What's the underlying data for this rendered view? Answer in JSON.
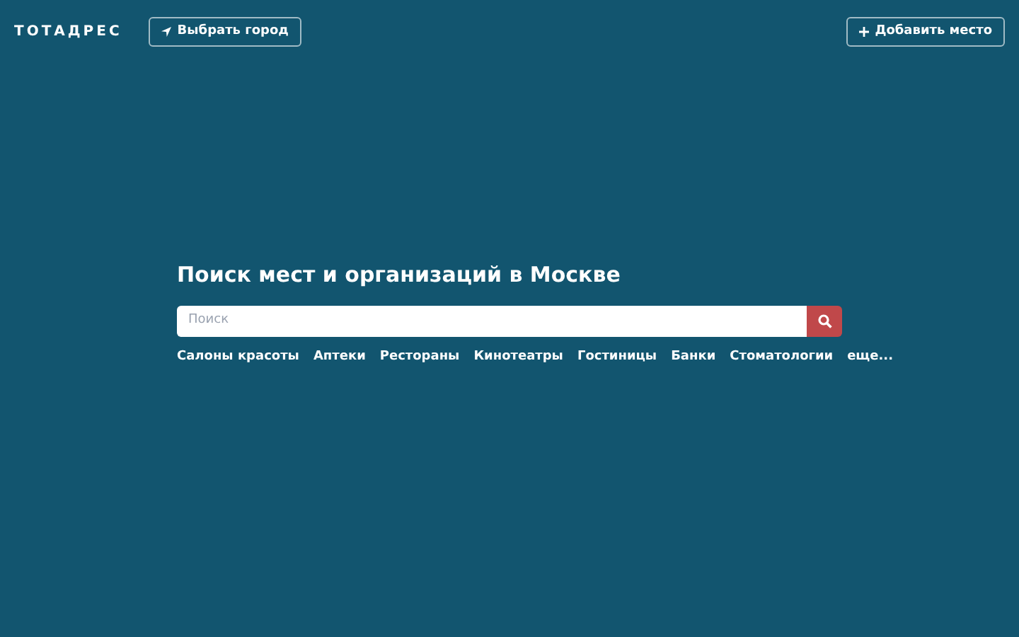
{
  "header": {
    "logo": "ТОТАДРЕС",
    "city_button": "Выбрать город",
    "add_button": "Добавить место"
  },
  "search": {
    "title": "Поиск мест и организаций в Москве",
    "placeholder": "Поиск"
  },
  "categories": [
    "Салоны красоты",
    "Аптеки",
    "Рестораны",
    "Кинотеатры",
    "Гостиницы",
    "Банки",
    "Стоматологии",
    "еще..."
  ]
}
